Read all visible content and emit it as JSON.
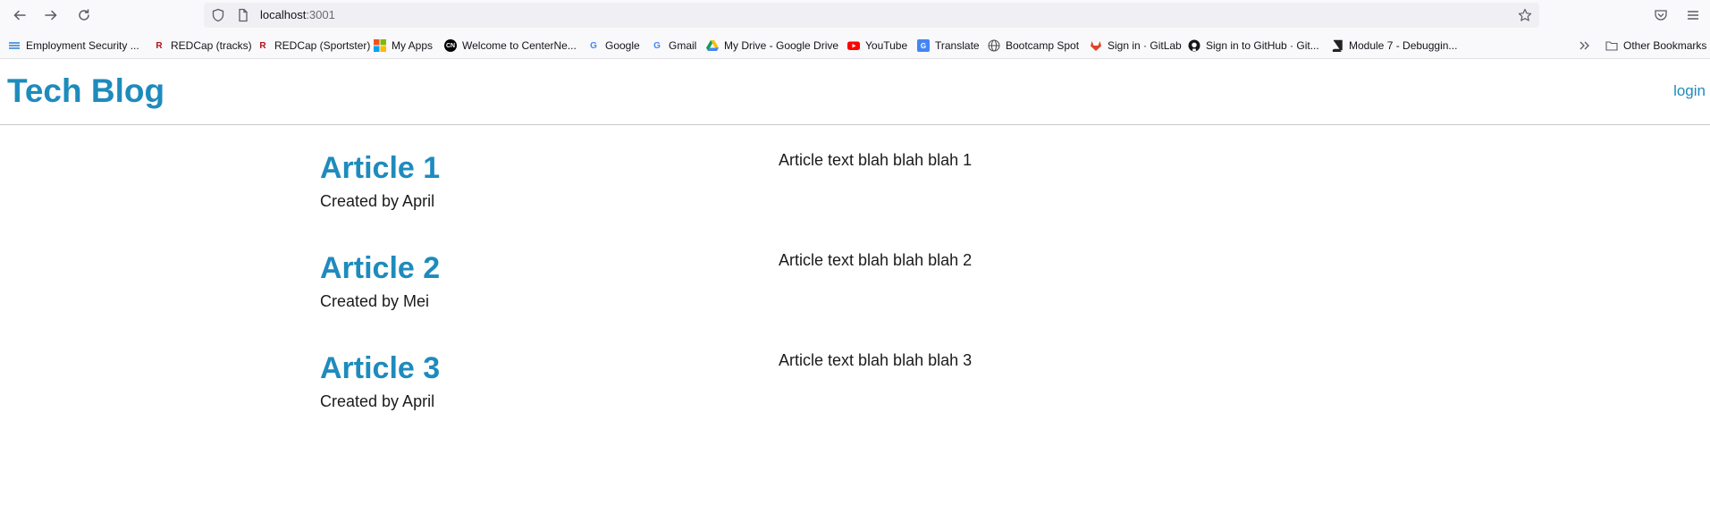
{
  "browser": {
    "url_host": "localhost",
    "url_port": ":3001",
    "bookmarks": [
      {
        "label": "Employment Security ...",
        "icon": "es-icon",
        "color": "#2a7fd4"
      },
      {
        "label": "REDCap (tracks)",
        "icon": "redcap-icon",
        "color": "#b0121b"
      },
      {
        "label": "REDCap (Sportster)",
        "icon": "redcap-icon",
        "color": "#b0121b"
      },
      {
        "label": "My Apps",
        "icon": "microsoft-icon",
        "color": "#f25022"
      },
      {
        "label": "Welcome to CenterNe...",
        "icon": "cn-icon",
        "color": "#000000"
      },
      {
        "label": "Google",
        "icon": "google-icon",
        "color": "#4285f4"
      },
      {
        "label": "Gmail",
        "icon": "google-icon",
        "color": "#4285f4"
      },
      {
        "label": "My Drive - Google Drive",
        "icon": "drive-icon",
        "color": "#0f9d58"
      },
      {
        "label": "YouTube",
        "icon": "youtube-icon",
        "color": "#ff0000"
      },
      {
        "label": "Translate",
        "icon": "translate-icon",
        "color": "#4285f4"
      },
      {
        "label": "Bootcamp Spot",
        "icon": "globe-icon",
        "color": "#555555"
      },
      {
        "label": "Sign in · GitLab",
        "icon": "gitlab-icon",
        "color": "#e24329"
      },
      {
        "label": "Sign in to GitHub · Git...",
        "icon": "github-icon",
        "color": "#181717"
      },
      {
        "label": "Module 7 - Debuggin...",
        "icon": "book-icon",
        "color": "#222222"
      }
    ],
    "other_bookmarks": "Other Bookmarks"
  },
  "header": {
    "site_title": "Tech Blog",
    "login_label": "login"
  },
  "articles": [
    {
      "title": "Article 1",
      "author": "Created by April",
      "body": "Article text blah blah blah 1"
    },
    {
      "title": "Article 2",
      "author": "Created by Mei",
      "body": "Article text blah blah blah 2"
    },
    {
      "title": "Article 3",
      "author": "Created by April",
      "body": "Article text blah blah blah 3"
    }
  ],
  "colors": {
    "accent": "#1e8bbd",
    "text": "#1b1b1b"
  }
}
